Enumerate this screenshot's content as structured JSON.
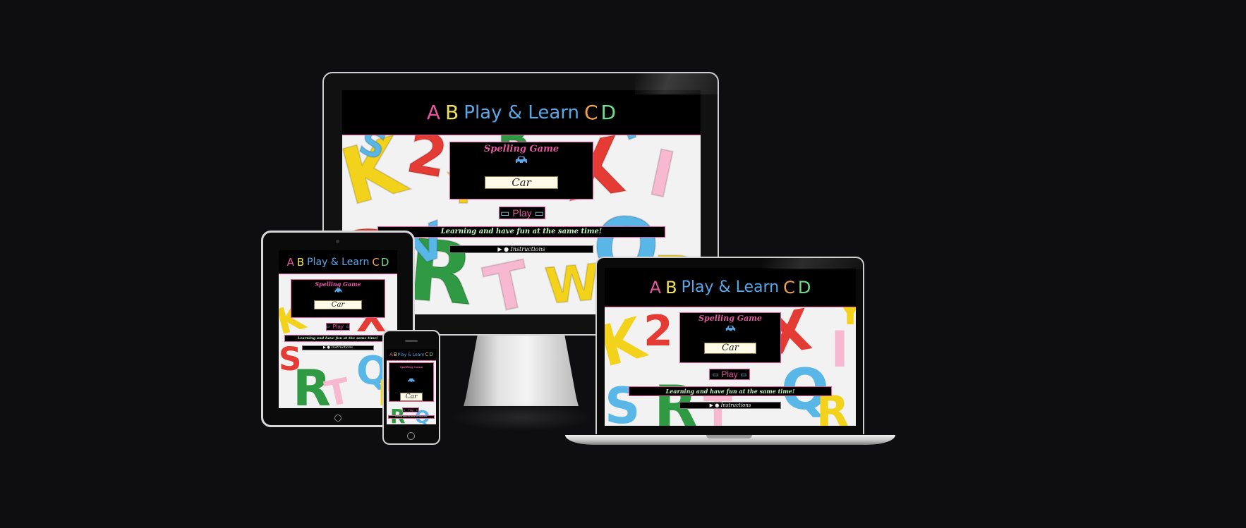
{
  "header": {
    "letter_a": "A",
    "letter_b": "B",
    "title": "Play & Learn",
    "letter_c": "C",
    "letter_d": "D"
  },
  "game": {
    "title": "Spelling Game",
    "icon": "car-icon",
    "word": "Car"
  },
  "play_button": {
    "label": "Play",
    "icon": "gamepad-icon"
  },
  "tagline": "Learning and have fun at the same time!",
  "instructions": {
    "marker": "▶",
    "icon": "info-icon",
    "label": "Instructions"
  },
  "colors": {
    "letter_a": "#e4579f",
    "letter_b": "#f1e05a",
    "title": "#5aa7e8",
    "letter_c": "#f0a04b",
    "letter_d": "#6fdc8c",
    "accent": "#e4579f",
    "tagline": "#bff5bf"
  }
}
